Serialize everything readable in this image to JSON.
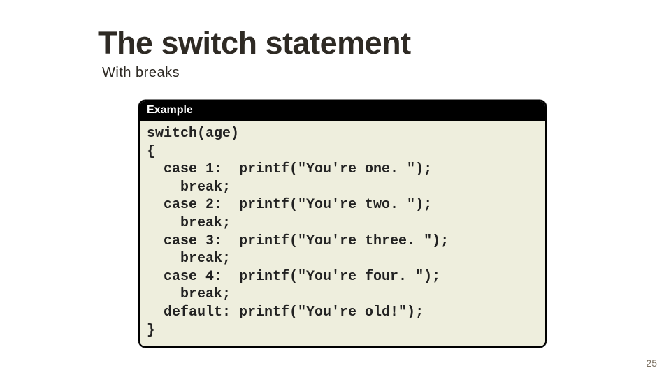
{
  "title": "The switch statement",
  "subtitle": "With breaks",
  "example": {
    "header": "Example",
    "code": "switch(age)\n{\n  case 1:  printf(\"You're one. \");\n    break;\n  case 2:  printf(\"You're two. \");\n    break;\n  case 3:  printf(\"You're three. \");\n    break;\n  case 4:  printf(\"You're four. \");\n    break;\n  default: printf(\"You're old!\");\n}"
  },
  "page_number": "25"
}
